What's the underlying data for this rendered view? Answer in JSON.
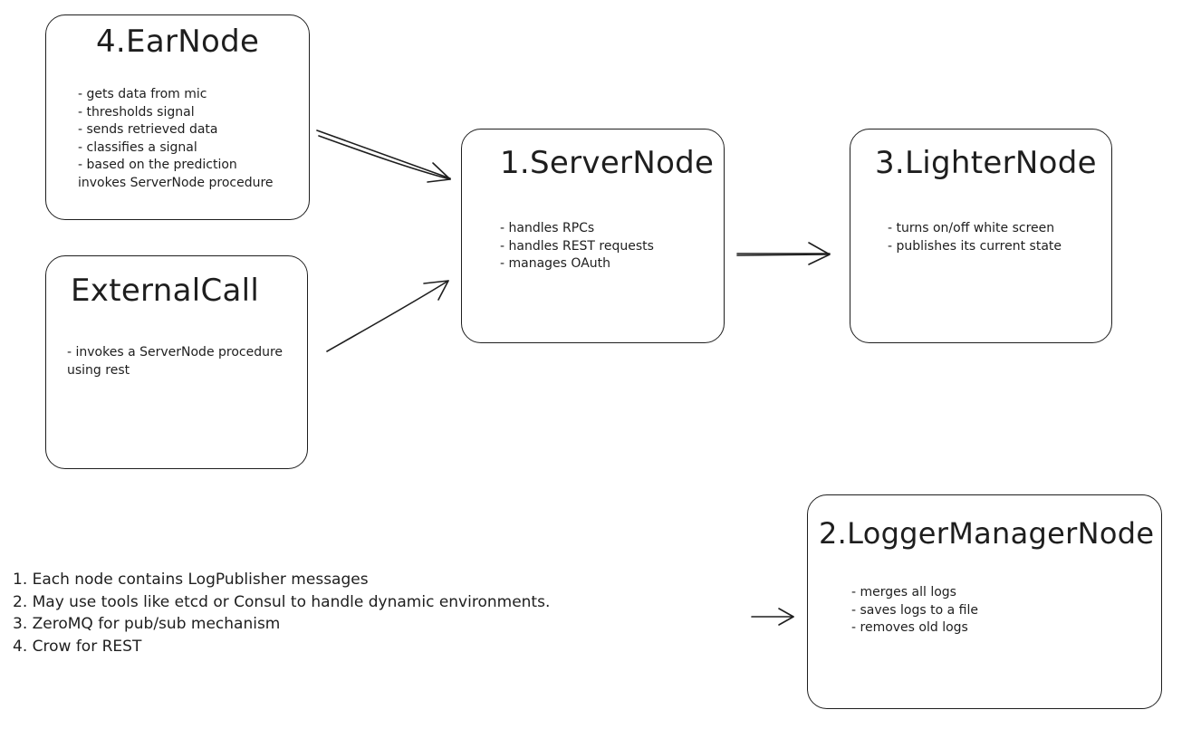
{
  "nodes": {
    "ear_node": {
      "title": "4.EarNode",
      "items": [
        "- gets data from mic",
        "- thresholds signal",
        "- sends retrieved data",
        "- classifies a signal",
        "- based on the prediction",
        "invokes ServerNode procedure"
      ]
    },
    "external_call": {
      "title": "ExternalCall",
      "items": [
        "- invokes a ServerNode procedure",
        "using rest"
      ]
    },
    "server_node": {
      "title": "1.ServerNode",
      "items": [
        "- handles RPCs",
        "- handles REST requests",
        "- manages OAuth"
      ]
    },
    "lighter_node": {
      "title": "3.LighterNode",
      "items": [
        "- turns on/off white screen",
        "- publishes its current state"
      ]
    },
    "logger_manager_node": {
      "title": "2.LoggerManagerNode",
      "items": [
        "- merges all logs",
        "- saves logs to a file",
        "- removes old logs"
      ]
    }
  },
  "notes": [
    "1. Each node contains LogPublisher messages",
    "2. May use tools like etcd or Consul to handle dynamic environments.",
    "3. ZeroMQ for pub/sub mechanism",
    "4. Crow for REST"
  ],
  "arrows": [
    {
      "from": "4.EarNode",
      "to": "1.ServerNode"
    },
    {
      "from": "ExternalCall",
      "to": "1.ServerNode"
    },
    {
      "from": "1.ServerNode",
      "to": "3.LighterNode"
    },
    {
      "from": "",
      "to": "2.LoggerManagerNode"
    }
  ],
  "colors": {
    "stroke": "#1e1e1e",
    "background": "#ffffff"
  }
}
